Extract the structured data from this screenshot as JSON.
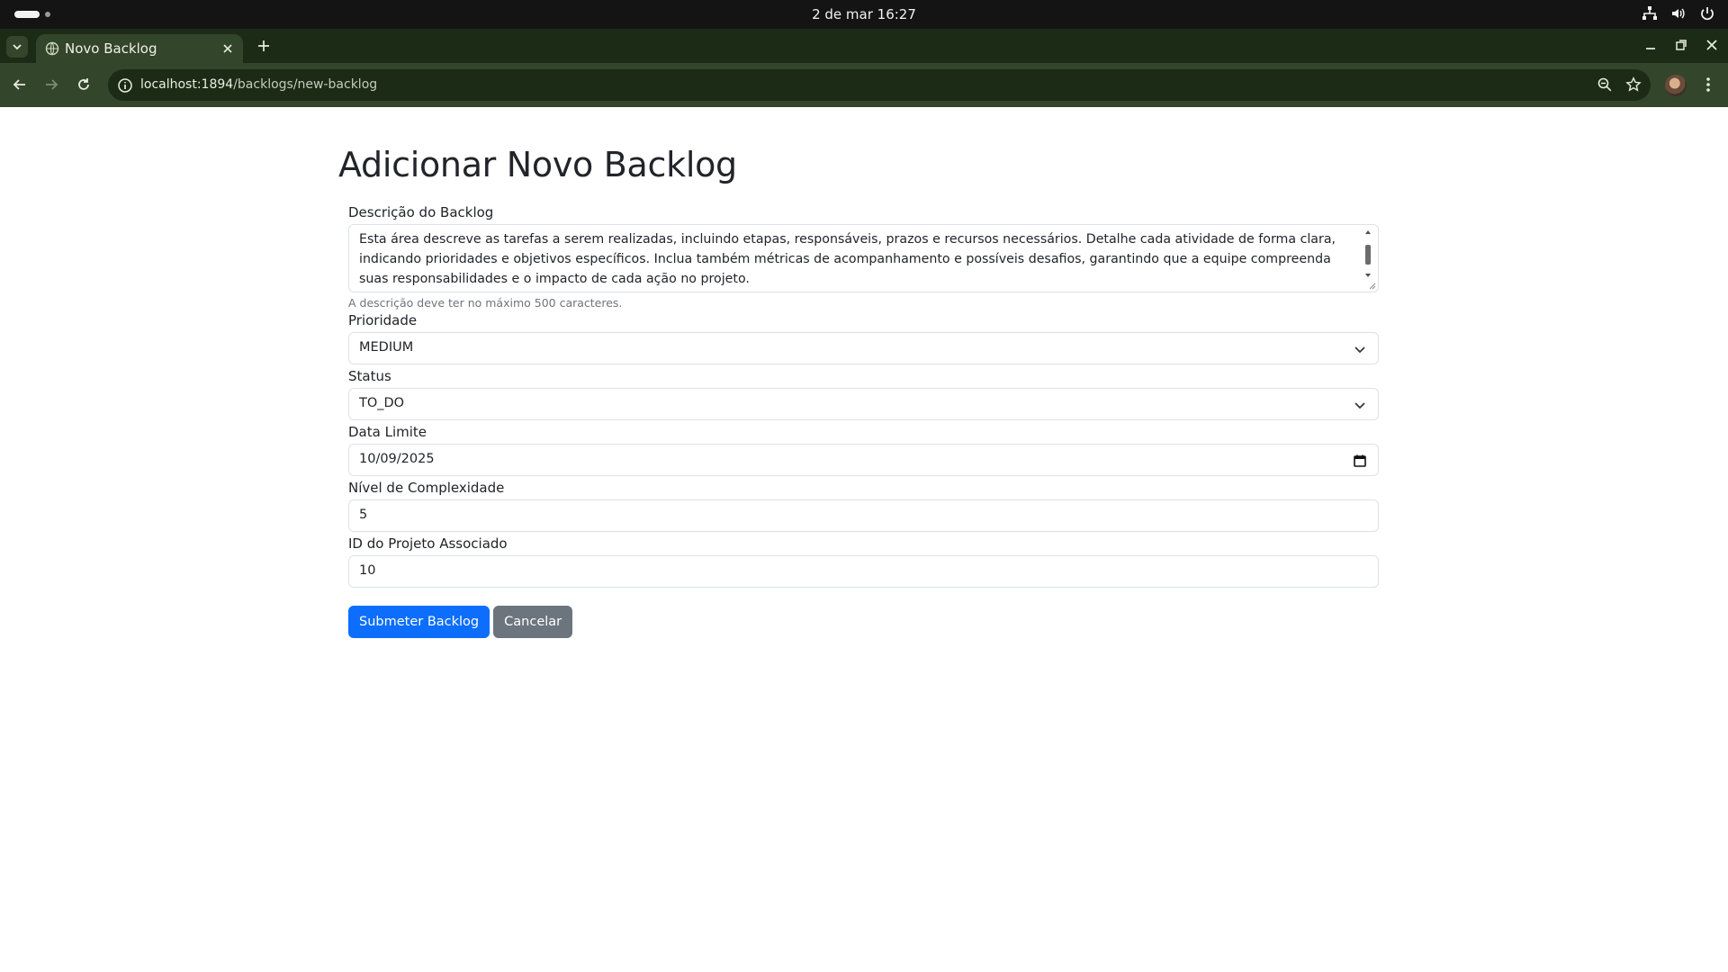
{
  "os": {
    "clock": "2 de mar  16:27",
    "tray_icons": [
      "network-icon",
      "volume-icon",
      "power-icon"
    ]
  },
  "browser": {
    "tab_title": "Novo Backlog",
    "url_host": "localhost:1894",
    "url_path": "/backlogs/new-backlog"
  },
  "page": {
    "title": "Adicionar Novo Backlog",
    "description": {
      "label": "Descrição do Backlog",
      "value": "Esta área descreve as tarefas a serem realizadas, incluindo etapas, responsáveis, prazos e recursos necessários. Detalhe cada atividade de forma clara, indicando prioridades e objetivos específicos. Inclua também métricas de acompanhamento e possíveis desafios, garantindo que a equipe compreenda suas responsabilidades e o impacto de cada ação no projeto.",
      "help": "A descrição deve ter no máximo 500 caracteres."
    },
    "priority": {
      "label": "Prioridade",
      "value": "MEDIUM"
    },
    "status": {
      "label": "Status",
      "value": "TO_DO"
    },
    "due_date": {
      "label": "Data Limite",
      "value": "10/09/2025"
    },
    "complexity": {
      "label": "Nível de Complexidade",
      "value": "5"
    },
    "project_id": {
      "label": "ID do Projeto Associado",
      "value": "10"
    },
    "submit_label": "Submeter Backlog",
    "cancel_label": "Cancelar"
  },
  "colors": {
    "primary": "#0d6efd",
    "secondary": "#6c757d",
    "browser_frame": "#33452a"
  }
}
